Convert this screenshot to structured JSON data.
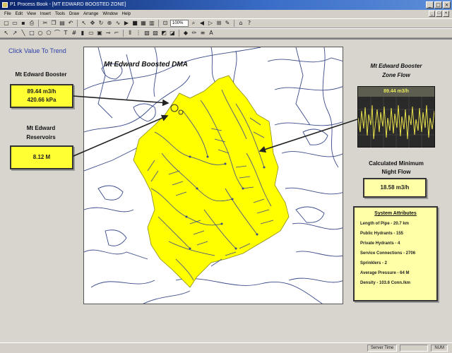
{
  "window": {
    "title": "P1 Process Book - [MT EDWARD BOOSTED ZONE]",
    "controls": [
      "_",
      "□",
      "×"
    ]
  },
  "menu": {
    "items": [
      "File",
      "Edit",
      "View",
      "Insert",
      "Tools",
      "Draw",
      "Arrange",
      "Window",
      "Help"
    ],
    "mdi_controls": [
      "_",
      "□",
      "×"
    ]
  },
  "toolbar": {
    "zoom_value": "100%"
  },
  "display": {
    "click_value_to_trend": "Click Value To Trend",
    "map_title": "Mt Edward Boosted DMA",
    "booster": {
      "label": "Mt Edward Booster",
      "flow": "89.44 m3/h",
      "pressure": "420.66 kPa"
    },
    "reservoirs": {
      "label_line1": "Mt Edward",
      "label_line2": "Reservoirs",
      "level": "8.12 M"
    },
    "zone_flow": {
      "label_line1": "Mt Edward Booster",
      "label_line2": "Zone Flow",
      "reading": "89.44 m3/h"
    },
    "min_night_flow": {
      "label_line1": "Calculated Minimum",
      "label_line2": "Night Flow",
      "value": "18.58 m3/h"
    },
    "attributes": {
      "title": "System Attributes",
      "lines": [
        "Length of Pipe - 20.7 km",
        "Public Hydrants - 155",
        "Private Hydrants - 4",
        "Service Connections - 2706",
        "Sprinklers - 2",
        "Average Pressure - 64 M",
        "Density - 103.6 Conn./km"
      ]
    }
  },
  "status": {
    "server_time": "Server Time",
    "ready": "NUM"
  },
  "colors": {
    "zone_fill": "#ffff00",
    "pipe": "#3a4a8a",
    "value_box": "#ffff33",
    "attr_box": "#ffffa8",
    "trend_line": "#e8e04a"
  }
}
